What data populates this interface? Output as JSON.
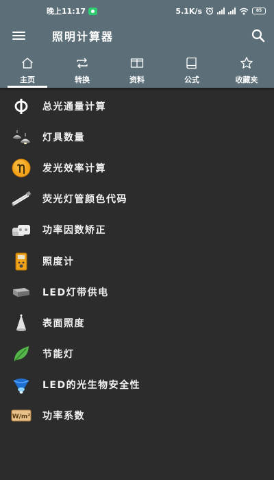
{
  "status_bar": {
    "time": "晚上11:17",
    "net_speed": "5.1K/s",
    "battery": "85"
  },
  "app_bar": {
    "title": "照明计算器"
  },
  "tabs": [
    {
      "label": "主页",
      "icon": "home-icon",
      "active": true
    },
    {
      "label": "转换",
      "icon": "swap-icon",
      "active": false
    },
    {
      "label": "资料",
      "icon": "open-book-icon",
      "active": false
    },
    {
      "label": "公式",
      "icon": "book-icon",
      "active": false
    },
    {
      "label": "收藏夹",
      "icon": "star-icon",
      "active": false
    }
  ],
  "items": [
    {
      "label": "总光通量计算",
      "icon": "phi-icon"
    },
    {
      "label": "灯具数量",
      "icon": "lamps-icon"
    },
    {
      "label": "发光效率计算",
      "icon": "eta-icon"
    },
    {
      "label": "荧光灯管颜色代码",
      "icon": "tube-icon"
    },
    {
      "label": "功率因数矫正",
      "icon": "capacitor-icon"
    },
    {
      "label": "照度计",
      "icon": "lux-meter-icon"
    },
    {
      "label": "LED灯带供电",
      "icon": "power-supply-icon"
    },
    {
      "label": "表面照度",
      "icon": "cone-light-icon"
    },
    {
      "label": "节能灯",
      "icon": "leaf-icon"
    },
    {
      "label": "LED的光生物安全性",
      "icon": "blue-light-icon"
    },
    {
      "label": "功率系数",
      "icon": "wm2-icon"
    }
  ],
  "wm2_badge": "W/m²",
  "colors": {
    "header": "#5c6f78",
    "background": "#2c2c2c"
  }
}
